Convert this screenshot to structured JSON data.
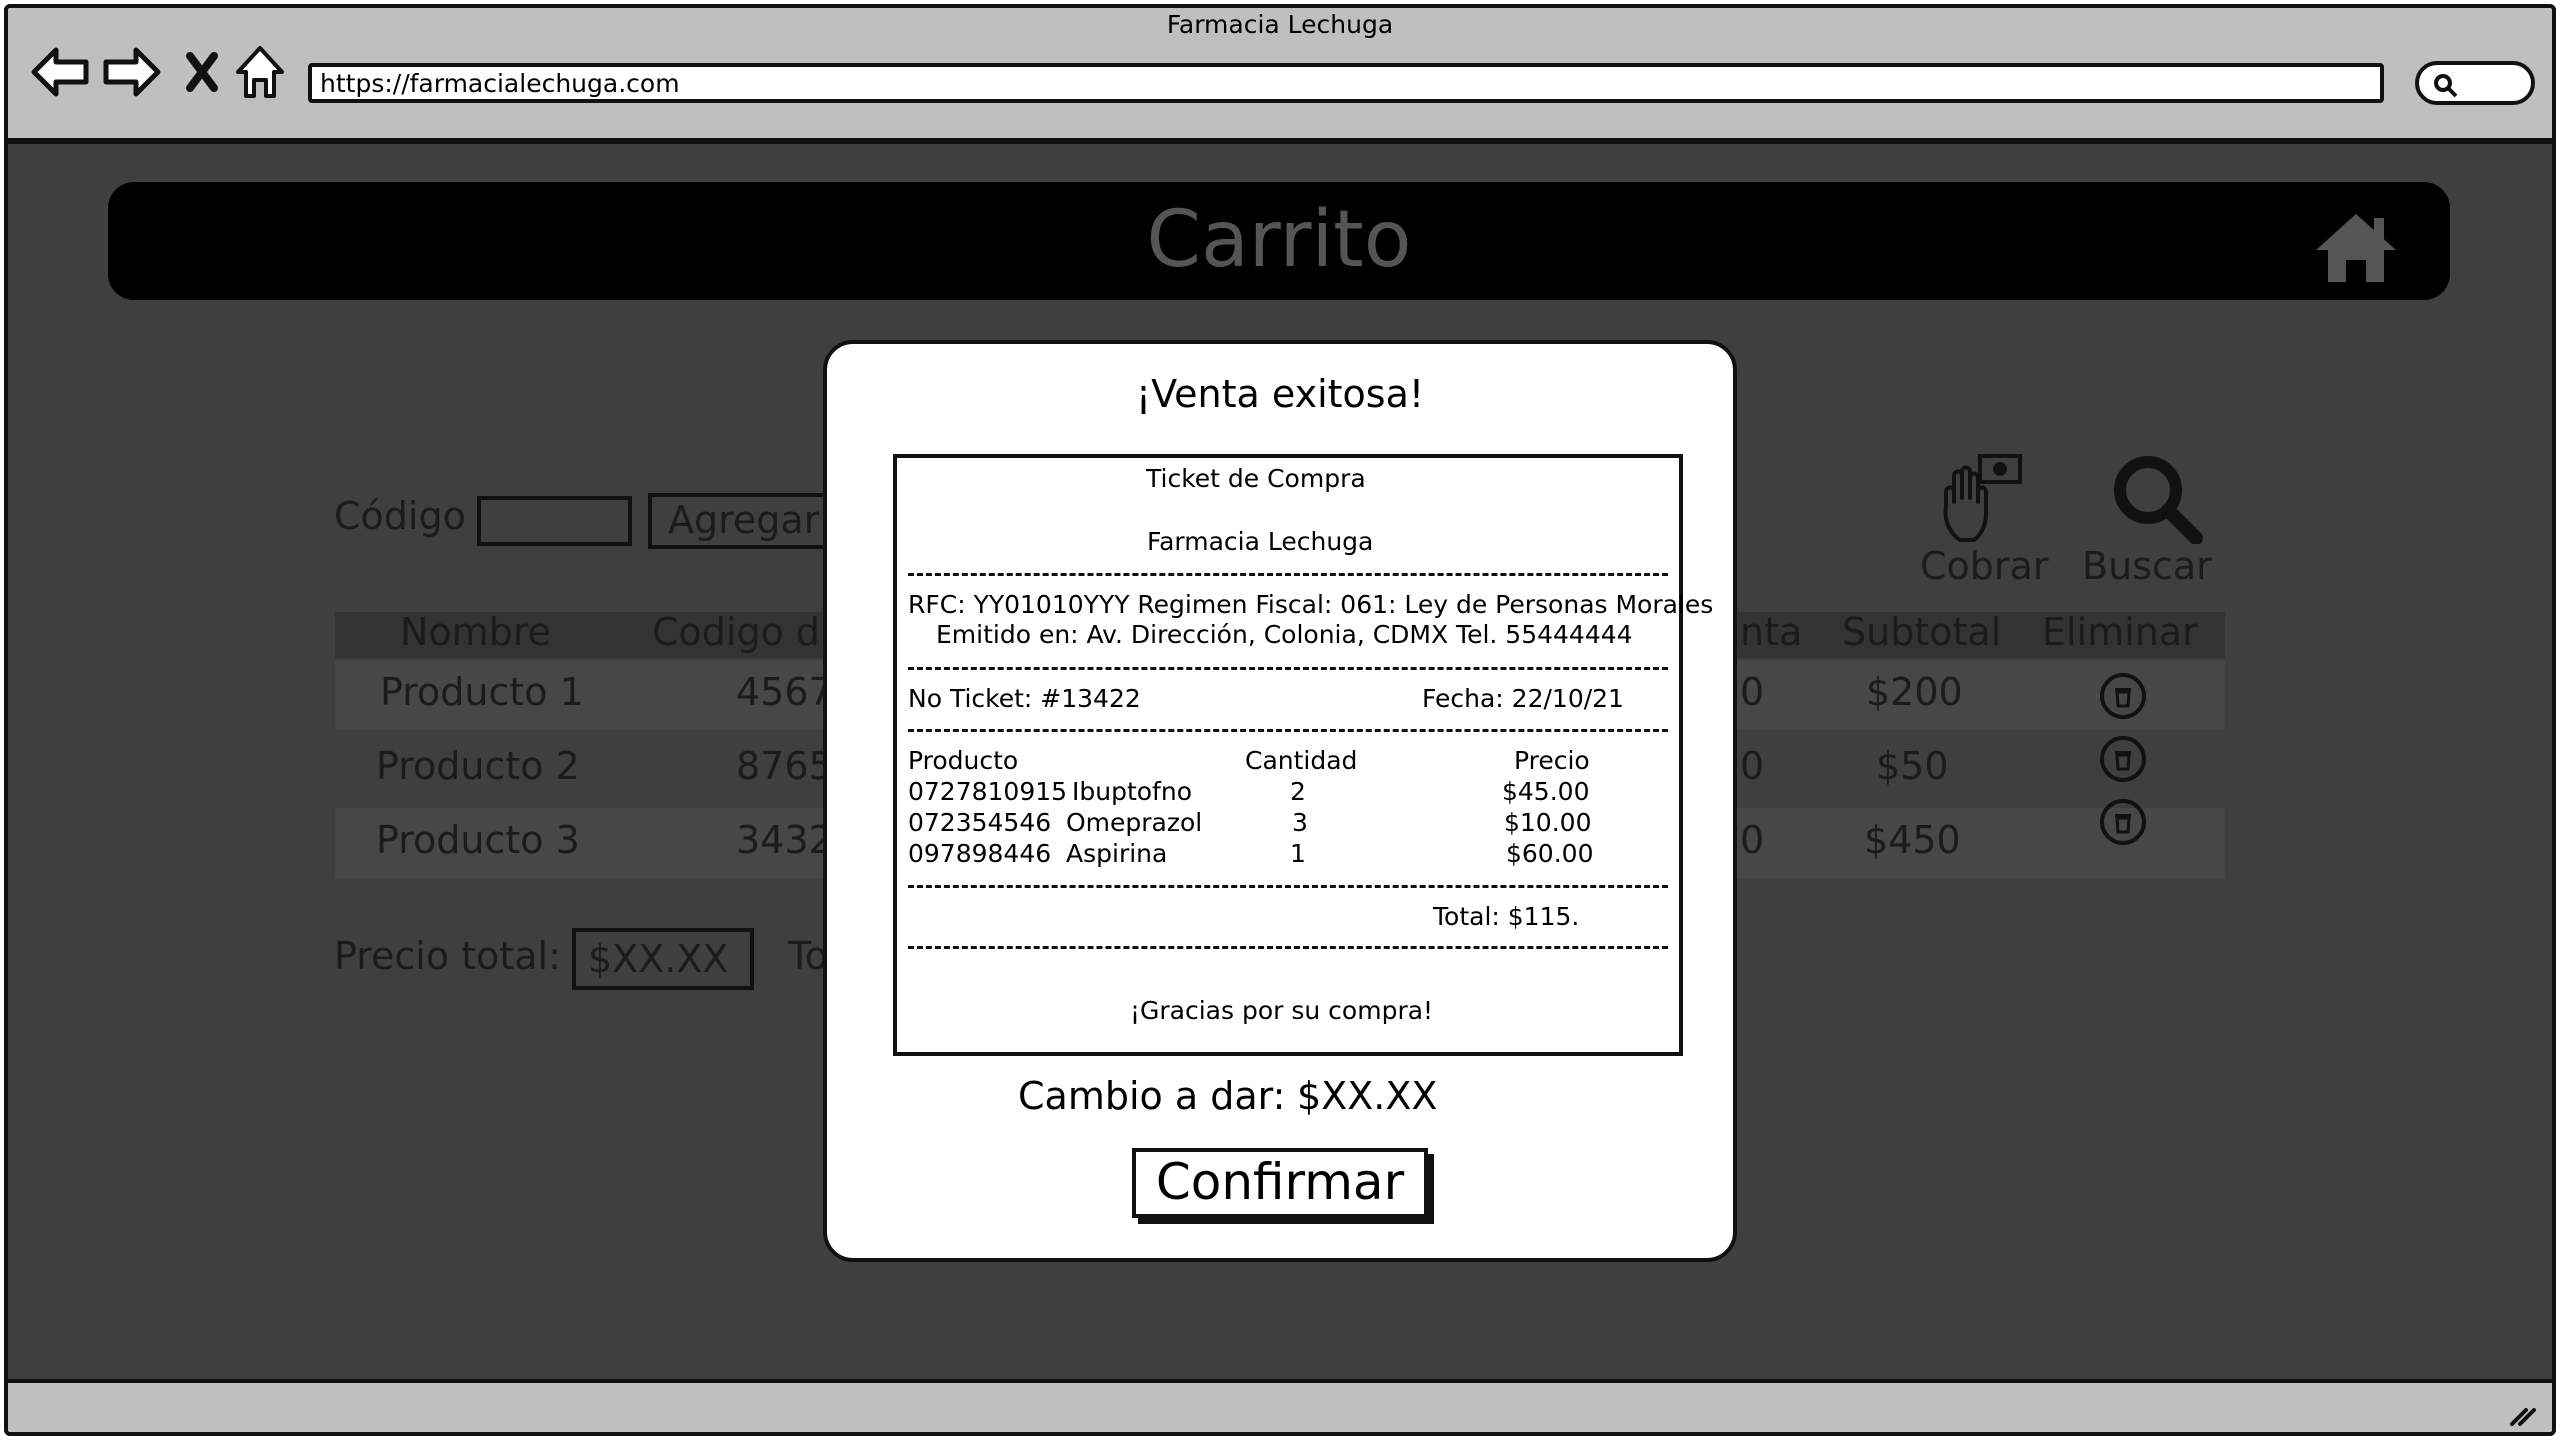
{
  "window": {
    "title": "Farmacia Lechuga",
    "url": "https://farmacialechuga.com"
  },
  "header": {
    "title": "Carrito"
  },
  "form": {
    "code_label": "Código",
    "add_button": "Agregar"
  },
  "actions": {
    "cobrar": "Cobrar",
    "buscar": "Buscar"
  },
  "table": {
    "headers": {
      "nombre": "Nombre",
      "codigo": "Codigo d",
      "venta_fragment": "nta",
      "subtotal": "Subtotal",
      "eliminar": "Eliminar"
    },
    "rows": [
      {
        "nombre": "Producto 1",
        "codigo": "4567",
        "venta_fragment": "0",
        "subtotal": "$200"
      },
      {
        "nombre": "Producto 2",
        "codigo": "8765",
        "venta_fragment": "0",
        "subtotal": "$50"
      },
      {
        "nombre": "Producto 3",
        "codigo": "3432",
        "venta_fragment": "0",
        "subtotal": "$450"
      }
    ]
  },
  "totals": {
    "label": "Precio total:",
    "value": "$XX.XX",
    "fragment": "To"
  },
  "modal": {
    "title": "¡Venta exitosa!",
    "ticket": {
      "heading": "Ticket de Compra",
      "store": "Farmacia Lechuga",
      "rfc_line": "RFC: YY01010YYY Regimen Fiscal: 061: Ley de Personas Morales",
      "address_line": "Emitido en: Av. Dirección, Colonia, CDMX Tel. 55444444",
      "ticket_no": "No Ticket: #13422",
      "date": "Fecha: 22/10/21",
      "col_producto": "Producto",
      "col_cantidad": "Cantidad",
      "col_precio": "Precio",
      "items": [
        {
          "code": "0727810915",
          "name": "Ibuptofno",
          "qty": "2",
          "price": "$45.00"
        },
        {
          "code": "072354546",
          "name": "Omeprazol",
          "qty": "3",
          "price": "$10.00"
        },
        {
          "code": "097898446",
          "name": "Aspirina",
          "qty": "1",
          "price": "$60.00"
        }
      ],
      "total": "Total: $115.",
      "thanks": "¡Gracias por su compra!"
    },
    "change_label": "Cambio a dar:",
    "change_value": "$XX.XX",
    "confirm_button": "Confirmar"
  }
}
